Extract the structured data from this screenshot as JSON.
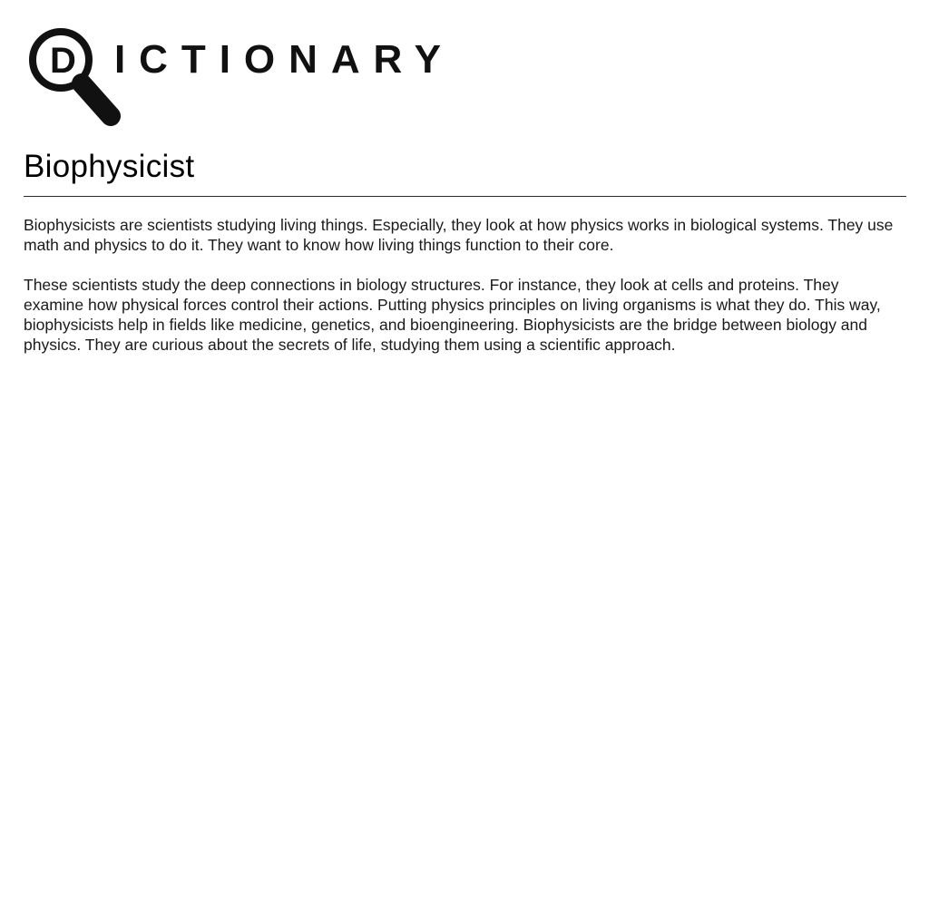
{
  "logo": {
    "text": "DICTIONARY",
    "icon": "magnifying-glass-icon"
  },
  "entry": {
    "title": "Biophysicist",
    "paragraphs": [
      "Biophysicists are scientists studying living things. Especially, they look at how physics works in biological systems. They use math and physics to do it. They want to know how living things function to their core.",
      "These scientists study the deep connections in biology structures. For instance, they look at cells and proteins. They examine how physical forces control their actions. Putting physics principles on living organisms is what they do. This way, biophysicists help in fields like medicine, genetics, and bioengineering. Biophysicists are the bridge between biology and physics. They are curious about the secrets of life, studying them using a scientific approach."
    ]
  },
  "colors": {
    "text": "#1a1a1a",
    "logo": "#111111",
    "background": "#ffffff"
  }
}
